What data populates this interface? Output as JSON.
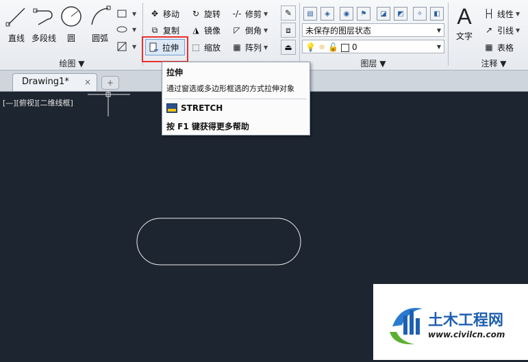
{
  "draw_panel": {
    "title": "绘图",
    "line": "直线",
    "polyline": "多段线",
    "circle": "圆",
    "arc": "圆弧"
  },
  "modify_panel": {
    "move": "移动",
    "rotate": "旋转",
    "trim": "修剪",
    "copy": "复制",
    "mirror": "镜像",
    "chamfer": "倒角",
    "stretch": "拉伸",
    "scale": "缩放",
    "array": "阵列"
  },
  "layer_panel": {
    "title": "图层",
    "state_value": "未保存的图层状态",
    "current_layer": "0"
  },
  "annotation_panel": {
    "title": "注释",
    "text": "文字",
    "dimension": "线性",
    "leader": "引线",
    "table": "表格"
  },
  "tabs": {
    "drawing_tab": "Drawing1*",
    "close": "×"
  },
  "viewport": {
    "label": "[—][俯视][二维线框]"
  },
  "tooltip": {
    "title": "拉伸",
    "description": "通过窗选或多边形框选的方式拉伸对象",
    "command": "STRETCH",
    "help": "按 F1 键获得更多帮助"
  },
  "watermark": {
    "cn": "土木工程网",
    "url": "www.civilcn.com"
  },
  "colors": {
    "canvas": "#1d2530",
    "highlight": "#e8302a",
    "ribbon": "#eceef2"
  }
}
